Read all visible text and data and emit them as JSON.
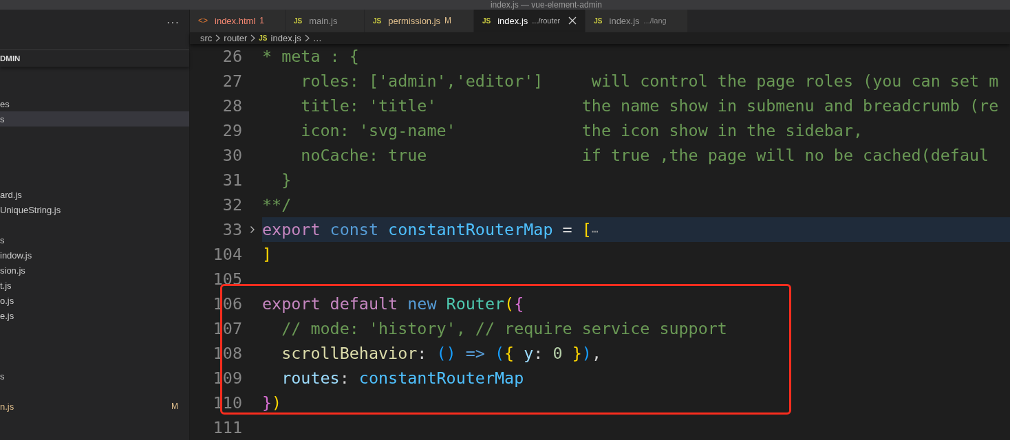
{
  "window": {
    "title": "index.js — vue-element-admin"
  },
  "sidebar": {
    "more": "···",
    "header": "DMIN",
    "groups": [
      [
        {
          "label": "es",
          "selected": false,
          "modified": false
        },
        {
          "label": "s",
          "selected": true,
          "modified": false
        }
      ],
      [
        {
          "label": "ard.js",
          "selected": false,
          "modified": false
        },
        {
          "label": "UniqueString.js",
          "selected": false,
          "modified": false
        }
      ],
      [
        {
          "label": "s",
          "selected": false,
          "modified": false
        },
        {
          "label": "indow.js",
          "selected": false,
          "modified": false
        },
        {
          "label": "sion.js",
          "selected": false,
          "modified": false
        },
        {
          "label": "t.js",
          "selected": false,
          "modified": false
        },
        {
          "label": "o.js",
          "selected": false,
          "modified": false
        },
        {
          "label": "e.js",
          "selected": false,
          "modified": false
        }
      ],
      [
        {
          "label": "s",
          "selected": false,
          "modified": false
        }
      ],
      [
        {
          "label": "n.js",
          "selected": false,
          "modified": true,
          "badge": "M"
        }
      ]
    ]
  },
  "tabs": [
    {
      "icon": "<>",
      "kind": "html",
      "label": "index.html",
      "badge": "1",
      "error": true,
      "modified": false,
      "selected": false
    },
    {
      "icon": "JS",
      "kind": "js",
      "label": "main.js",
      "error": false,
      "modified": false,
      "selected": false
    },
    {
      "icon": "JS",
      "kind": "js",
      "label": "permission.js",
      "badge": "M",
      "error": false,
      "modified": true,
      "selected": false
    },
    {
      "icon": "JS",
      "kind": "js",
      "label": "index.js",
      "description": ".../router",
      "error": false,
      "modified": false,
      "selected": true
    },
    {
      "icon": "JS",
      "kind": "js",
      "label": "index.js",
      "description": ".../lang",
      "error": false,
      "modified": false,
      "selected": false
    }
  ],
  "breadcrumb": [
    {
      "text": "src"
    },
    {
      "text": "router"
    },
    {
      "icon": "JS",
      "text": "index.js"
    },
    {
      "text": "…"
    }
  ],
  "code": [
    {
      "number": "26",
      "tokens": [
        {
          "text": "* meta : {",
          "kind": "comment"
        }
      ]
    },
    {
      "number": "27",
      "tokens": [
        {
          "text": "    roles: ['admin','editor']     will control the page roles (you can set m",
          "kind": "comment"
        }
      ]
    },
    {
      "number": "28",
      "tokens": [
        {
          "text": "    title: 'title'               the name show in submenu and breadcrumb (re",
          "kind": "comment"
        }
      ]
    },
    {
      "number": "29",
      "tokens": [
        {
          "text": "    icon: 'svg-name'             the icon show in the sidebar,",
          "kind": "comment"
        }
      ]
    },
    {
      "number": "30",
      "tokens": [
        {
          "text": "    noCache: true                if true ,the page will no be cached(defaul",
          "kind": "comment"
        }
      ]
    },
    {
      "number": "31",
      "tokens": [
        {
          "text": "  }",
          "kind": "comment"
        }
      ]
    },
    {
      "number": "32",
      "tokens": [
        {
          "text": "**/",
          "kind": "comment"
        }
      ]
    },
    {
      "number": "33",
      "folded": true,
      "tokens": [
        {
          "text": "export ",
          "kind": "keyword"
        },
        {
          "text": "const ",
          "kind": "storage"
        },
        {
          "text": "constantRouterMap",
          "kind": "variable"
        },
        {
          "text": " = ",
          "kind": "plain"
        },
        {
          "text": "[",
          "kind": "bracket1"
        },
        {
          "text": "⋯",
          "kind": "fold"
        }
      ]
    },
    {
      "number": "104",
      "tokens": [
        {
          "text": "]",
          "kind": "bracket1"
        }
      ]
    },
    {
      "number": "105"
    },
    {
      "number": "106",
      "tokens": [
        {
          "text": "export ",
          "kind": "keyword"
        },
        {
          "text": "default ",
          "kind": "keyword"
        },
        {
          "text": "new ",
          "kind": "storage"
        },
        {
          "text": "Router",
          "kind": "class"
        },
        {
          "text": "(",
          "kind": "bracket1"
        },
        {
          "text": "{",
          "kind": "bracket2"
        }
      ]
    },
    {
      "number": "107",
      "tokens": [
        {
          "text": "  // mode: 'history', // require service support",
          "kind": "comment"
        }
      ]
    },
    {
      "number": "108",
      "tokens": [
        {
          "text": "  scrollBehavior",
          "kind": "function"
        },
        {
          "text": ": ",
          "kind": "plain"
        },
        {
          "text": "() ",
          "kind": "bracket3"
        },
        {
          "text": "=> ",
          "kind": "storage"
        },
        {
          "text": "(",
          "kind": "bracket3"
        },
        {
          "text": "{ ",
          "kind": "bracket1"
        },
        {
          "text": "y",
          "kind": "property"
        },
        {
          "text": ": ",
          "kind": "plain"
        },
        {
          "text": "0 ",
          "kind": "number"
        },
        {
          "text": "}",
          "kind": "bracket1"
        },
        {
          "text": ")",
          "kind": "bracket3"
        },
        {
          "text": ",",
          "kind": "plain"
        }
      ]
    },
    {
      "number": "109",
      "tokens": [
        {
          "text": "  routes",
          "kind": "property"
        },
        {
          "text": ": ",
          "kind": "plain"
        },
        {
          "text": "constantRouterMap",
          "kind": "variable"
        }
      ]
    },
    {
      "number": "110",
      "tokens": [
        {
          "text": "}",
          "kind": "bracket2"
        },
        {
          "text": ")",
          "kind": "bracket1"
        }
      ]
    },
    {
      "number": "111"
    }
  ]
}
